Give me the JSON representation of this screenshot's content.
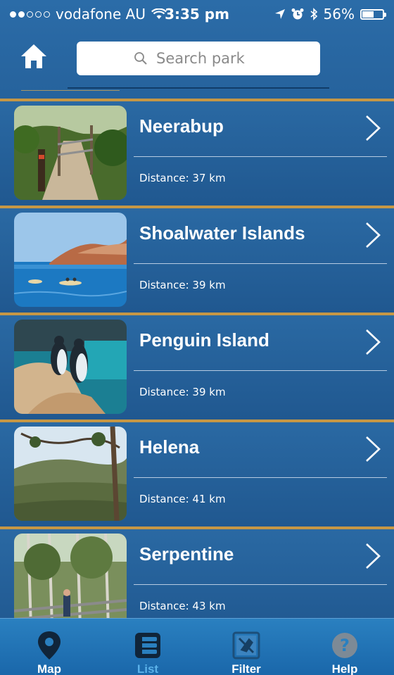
{
  "status_bar": {
    "carrier": "vodafone AU",
    "time": "3:35 pm",
    "battery": "56%",
    "battery_level": 0.56
  },
  "top_bar": {
    "home_icon": "home-icon",
    "search_placeholder": "Search park",
    "search_icon": "search-icon"
  },
  "parks": [
    {
      "name": "Neerabup",
      "distance": "Distance: 37 km"
    },
    {
      "name": "Shoalwater Islands",
      "distance": "Distance: 39 km"
    },
    {
      "name": "Penguin Island",
      "distance": "Distance: 39 km"
    },
    {
      "name": "Helena",
      "distance": "Distance: 41 km"
    },
    {
      "name": "Serpentine",
      "distance": "Distance: 43 km"
    }
  ],
  "tabs": [
    {
      "label": "Map",
      "icon": "map-pin-icon",
      "active": false
    },
    {
      "label": "List",
      "icon": "list-icon",
      "active": true
    },
    {
      "label": "Filter",
      "icon": "filter-icon",
      "active": false
    },
    {
      "label": "Help",
      "icon": "help-icon",
      "active": false
    }
  ],
  "colors": {
    "accent_gold": "#c69745",
    "active_tab": "#5bb2ea",
    "background_blue": "#205890"
  }
}
